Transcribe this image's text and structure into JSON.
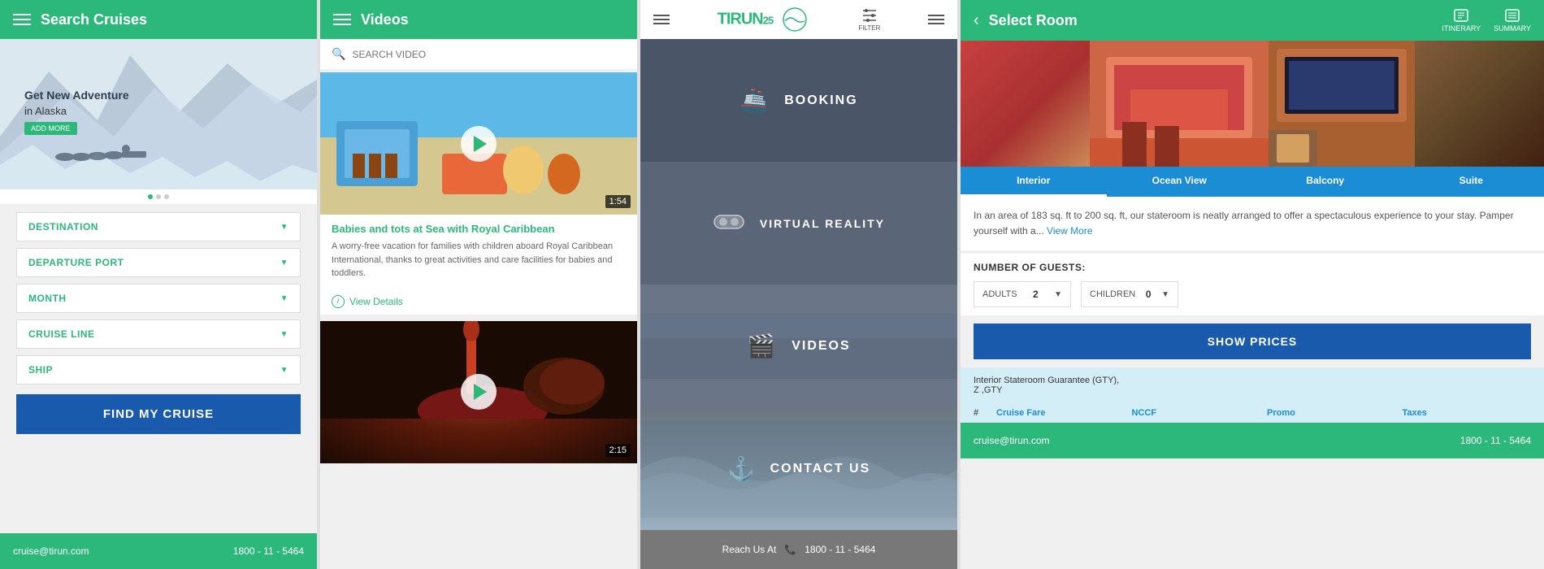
{
  "panel1": {
    "header": "Search Cruises",
    "hero_text_main": "Get New Adventure",
    "hero_text_sub": "in Alaska",
    "hero_btn": "ADD MORE",
    "fields": [
      {
        "label": "DESTINATION"
      },
      {
        "label": "DEPARTURE PORT"
      },
      {
        "label": "MONTH"
      },
      {
        "label": "CRUISE LINE"
      },
      {
        "label": "SHIP"
      }
    ],
    "find_btn": "FIND MY CRUISE",
    "footer_email": "cruise@tirun.com",
    "footer_phone": "1800 - 11 - 5464"
  },
  "panel2": {
    "header": "Videos",
    "search_placeholder": "SEARCH VIDEO",
    "video1": {
      "duration": "1:54",
      "title": "Babies and tots at Sea with Royal Caribbean",
      "description": "A worry-free vacation for families with children aboard Royal Caribbean International, thanks to great activities and care facilities for babies and toddlers.",
      "view_details": "View Details"
    },
    "video2": {
      "duration": "2:15"
    }
  },
  "panel3": {
    "logo": "TIRUN",
    "logo_suffix": "25",
    "filter_label": "FILTER",
    "menu_items": [
      {
        "id": "booking",
        "label": "BOOKING",
        "icon": "🚢"
      },
      {
        "id": "vr",
        "label": "VIRTUAL REALITY",
        "icon": "🥽"
      },
      {
        "id": "videos",
        "label": "VIDEOS",
        "icon": "🎬"
      },
      {
        "id": "contact",
        "label": "CONTACT US",
        "icon": "⚓"
      }
    ],
    "reach_us": "Reach Us At",
    "phone_icon": "📞",
    "phone": "1800 - 11 - 5464"
  },
  "panel4": {
    "header": "Select Room",
    "header_icons": [
      {
        "label": "ITINERARY"
      },
      {
        "label": "SUMMARY"
      }
    ],
    "tabs": [
      {
        "label": "Interior",
        "active": true
      },
      {
        "label": "Ocean View"
      },
      {
        "label": "Balcony"
      },
      {
        "label": "Suite"
      }
    ],
    "description": "In an area of 183 sq. ft to 200 sq. ft, our stateroom is neatly arranged to offer a spectaculous experience to your stay. Pamper yourself with a...",
    "view_more": "View More",
    "guests_label": "NUMBER OF GUESTS:",
    "adults_label": "ADULTS",
    "adults_value": "2",
    "children_label": "CHILDREN",
    "children_value": "0",
    "show_prices_btn": "SHOW PRICES",
    "guarantee_label": "Interior Stateroom Guarantee (GTY),",
    "guarantee_type": "Z ,GTY",
    "price_cols": [
      "#",
      "Cruise Fare",
      "NCCF",
      "Promo",
      "Taxes"
    ],
    "footer_email": "cruise@tirun.com",
    "footer_phone": "1800 - 11 - 5464"
  },
  "colors": {
    "green": "#2cb87a",
    "blue_dark": "#1a5aad",
    "blue_light": "#1a8dd4",
    "gray_header": "#4a5568"
  }
}
